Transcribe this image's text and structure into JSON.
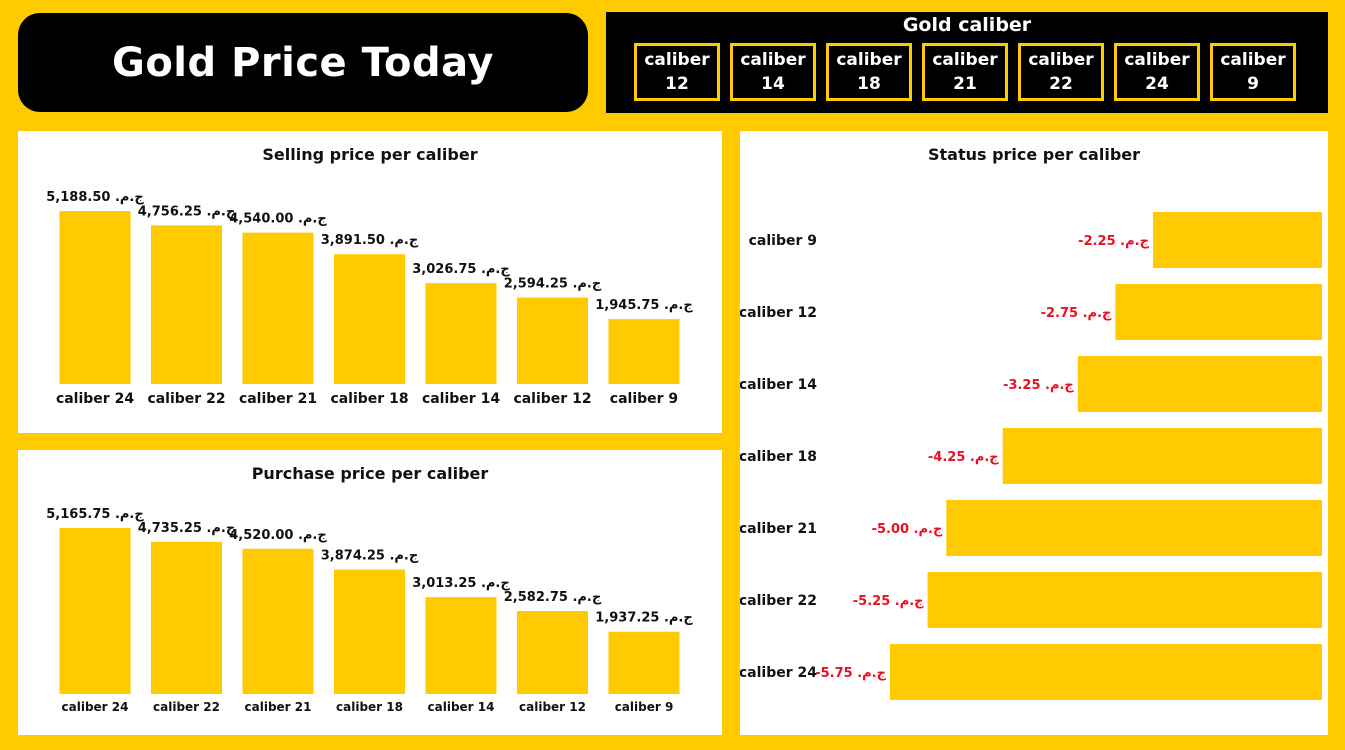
{
  "header": {
    "title": "Gold Price Today"
  },
  "slicer": {
    "title": "Gold caliber",
    "items": [
      {
        "line1": "caliber",
        "line2": "12"
      },
      {
        "line1": "caliber",
        "line2": "14"
      },
      {
        "line1": "caliber",
        "line2": "18"
      },
      {
        "line1": "caliber",
        "line2": "21"
      },
      {
        "line1": "caliber",
        "line2": "22"
      },
      {
        "line1": "caliber",
        "line2": "24"
      },
      {
        "line1": "caliber",
        "line2": "9"
      }
    ]
  },
  "colors": {
    "gold": "#FDCB00",
    "black": "#000000",
    "negative": "#E81123"
  },
  "chart_data": [
    {
      "type": "bar",
      "title": "Selling price per caliber",
      "categories": [
        "caliber 24",
        "caliber 22",
        "caliber 21",
        "caliber 18",
        "caliber 14",
        "caliber 12",
        "caliber 9"
      ],
      "values": [
        5188.5,
        4756.25,
        4540.0,
        3891.5,
        3026.75,
        2594.25,
        1945.75
      ],
      "data_labels": [
        "5,188.50 .ج.م",
        "4,756.25 .ج.م",
        "4,540.00 .ج.م",
        "3,891.50 .ج.م",
        "3,026.75 .ج.م",
        "2,594.25 .ج.م",
        "1,945.75 .ج.م"
      ],
      "ylim": [
        0,
        5188.5
      ]
    },
    {
      "type": "bar",
      "title": "Purchase price per caliber",
      "categories": [
        "caliber 24",
        "caliber 22",
        "caliber 21",
        "caliber 18",
        "caliber 14",
        "caliber 12",
        "caliber 9"
      ],
      "values": [
        5165.75,
        4735.25,
        4520.0,
        3874.25,
        3013.25,
        2582.75,
        1937.25
      ],
      "data_labels": [
        "5,165.75 .ج.م",
        "4,735.25 .ج.م",
        "4,520.00 .ج.م",
        "3,874.25 .ج.م",
        "3,013.25 .ج.م",
        "2,582.75 .ج.م",
        "1,937.25 .ج.م"
      ],
      "ylim": [
        0,
        5165.75
      ]
    },
    {
      "type": "bar",
      "orientation": "horizontal",
      "title": "Status price per caliber",
      "categories": [
        "caliber 9",
        "caliber 12",
        "caliber 14",
        "caliber 18",
        "caliber 21",
        "caliber 22",
        "caliber 24"
      ],
      "values": [
        -2.25,
        -2.75,
        -3.25,
        -4.25,
        -5.0,
        -5.25,
        -5.75
      ],
      "data_labels": [
        "-2.25 .ج.م",
        "-2.75 .ج.م",
        "-3.25 .ج.م",
        "-4.25 .ج.م",
        "-5.00 .ج.م",
        "-5.25 .ج.م",
        "-5.75 .ج.م"
      ],
      "xlim": [
        -5.75,
        0
      ]
    }
  ]
}
